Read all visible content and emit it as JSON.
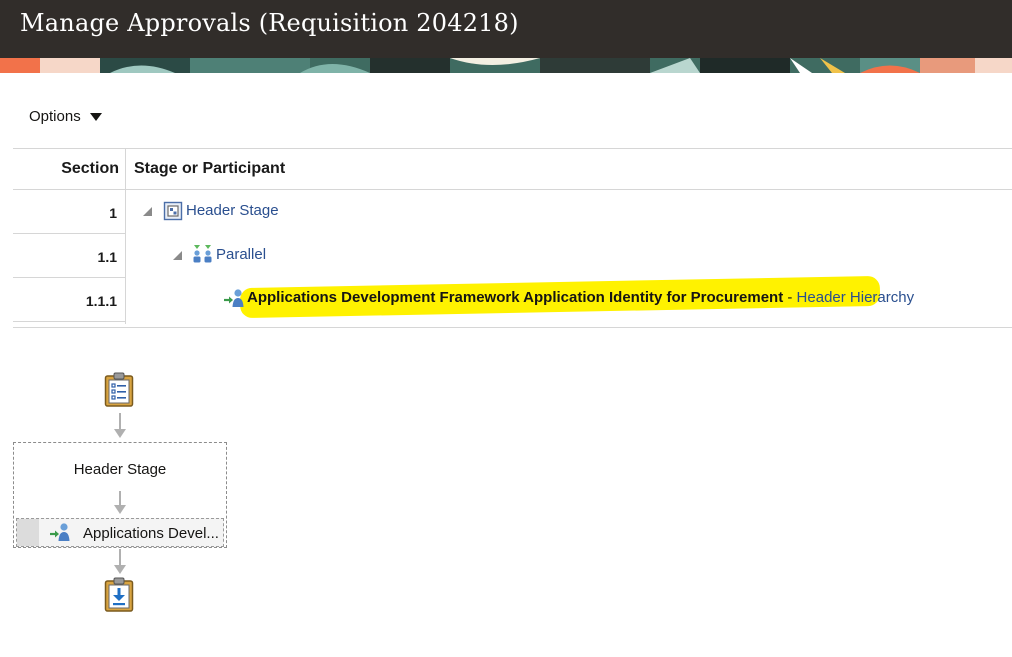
{
  "header": {
    "title": "Manage Approvals (Requisition 204218)"
  },
  "toolbar": {
    "options_label": "Options"
  },
  "table": {
    "columns": [
      "Section",
      "Stage or Participant"
    ],
    "rows": [
      {
        "section": "1",
        "label": "Header Stage",
        "icon": "stage-icon"
      },
      {
        "section": "1.1",
        "label": "Parallel",
        "icon": "parallel-group-icon"
      },
      {
        "section": "1.1.1",
        "participant": "Applications Development Framework Application Identity for Procurement",
        "separator": " - ",
        "rule": "Header Hierarchy",
        "icon": "participant-icon"
      }
    ]
  },
  "diagram": {
    "start_icon": "clipboard-list-icon",
    "stage_label": "Header Stage",
    "participant_label": "Applications Devel...",
    "end_icon": "clipboard-download-icon"
  },
  "colors": {
    "header_bg": "#312d2a",
    "link": "#2a4f8f",
    "highlight": "#fff200"
  }
}
